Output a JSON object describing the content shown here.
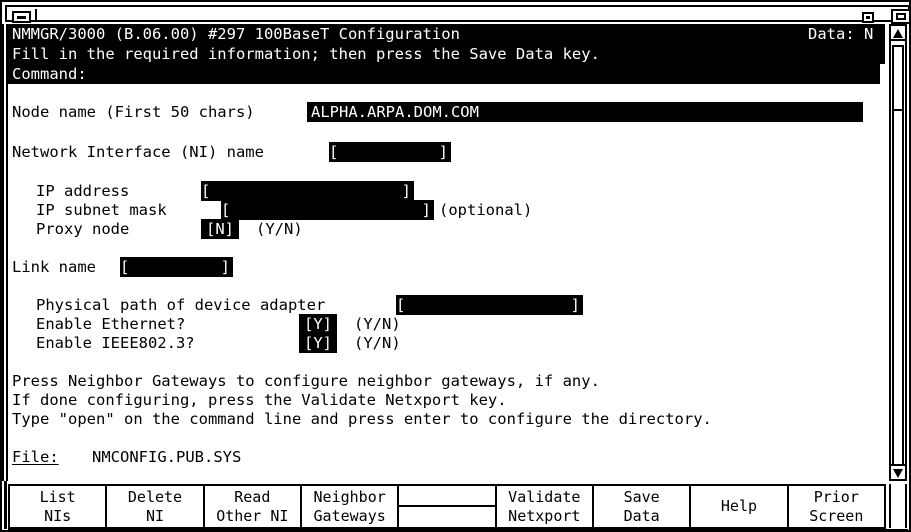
{
  "window": {
    "title": "",
    "minimize_icon": "minimize-icon",
    "restore_icon": "restore-icon",
    "maximize_icon": "maximize-icon"
  },
  "header": {
    "line1_left": "NMMGR/3000 (B.06.00) #297 100BaseT Configuration",
    "line1_right": "Data: N",
    "line2": "Fill in the required information; then press the Save Data key.",
    "command_label": "Command:",
    "command_value": ""
  },
  "form": {
    "node_name_label": "Node name (First 50 chars)",
    "node_name_value": "ALPHA.ARPA.DOM.COM",
    "ni_name_label": "Network Interface (NI) name",
    "ni_name_value": "",
    "ip_address_label": "IP address",
    "ip_address_value": "",
    "ip_subnet_label": "IP subnet mask",
    "ip_subnet_value": "",
    "ip_subnet_suffix": "(optional)",
    "proxy_node_label": "Proxy node",
    "proxy_node_value": "N",
    "proxy_node_hint": "(Y/N)",
    "link_name_label": "Link name",
    "link_name_value": "",
    "phys_path_label": "Physical path of device adapter",
    "phys_path_value": "",
    "enable_ethernet_label": "Enable Ethernet?",
    "enable_ethernet_value": "Y",
    "enable_ethernet_hint": "(Y/N)",
    "enable_ieee_label": "Enable IEEE802.3?",
    "enable_ieee_value": "Y",
    "enable_ieee_hint": "(Y/N)"
  },
  "instructions": {
    "line1": "Press Neighbor Gateways to configure neighbor gateways, if any.",
    "line2": "If done configuring, press the Validate Netxport key.",
    "line3": "Type \"open\" on the command line and press enter to configure the directory."
  },
  "file": {
    "label": "File:",
    "value": "NMCONFIG.PUB.SYS"
  },
  "function_keys": [
    {
      "line1": "List",
      "line2": "NIs"
    },
    {
      "line1": "Delete",
      "line2": "NI"
    },
    {
      "line1": "Read",
      "line2": "Other NI"
    },
    {
      "line1": "Neighbor",
      "line2": "Gateways"
    },
    {
      "line1": "",
      "line2": ""
    },
    {
      "line1": "Validate",
      "line2": "Netxport"
    },
    {
      "line1": "Save",
      "line2": "Data"
    },
    {
      "line1": "Help",
      "line2": ""
    },
    {
      "line1": "Prior",
      "line2": "Screen"
    }
  ],
  "scrollbar": {
    "up_icon": "scroll-up-arrow-icon",
    "down_icon": "scroll-down-arrow-icon"
  },
  "colors": {
    "background": "#ffffff",
    "foreground": "#000000",
    "inverse_bg": "#000000",
    "inverse_fg": "#ffffff"
  }
}
